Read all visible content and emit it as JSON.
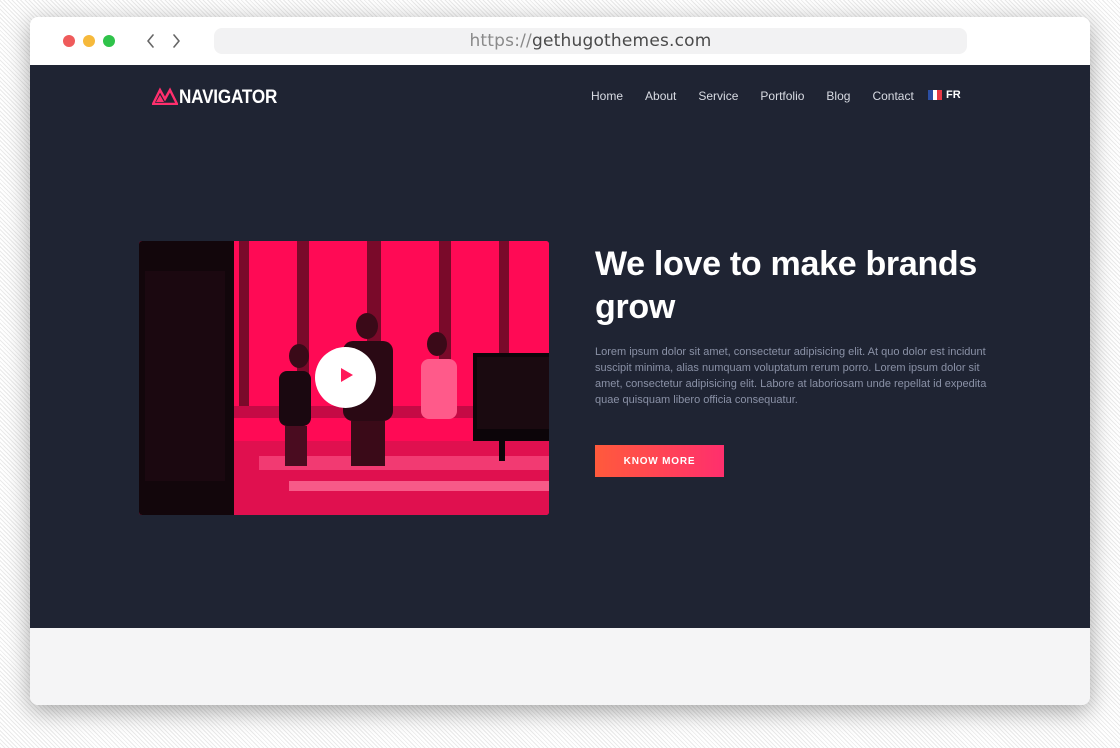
{
  "browser": {
    "url_protocol": "https://",
    "url_host": "gethugothemes.com"
  },
  "site": {
    "logo_text": "NAVIGATOR",
    "menu": [
      "Home",
      "About",
      "Service",
      "Portfolio",
      "Blog",
      "Contact"
    ],
    "language": "FR"
  },
  "hero": {
    "headline": "We love to make brands grow",
    "lead": "Lorem ipsum dolor sit amet, consectetur adipisicing elit. At quo dolor est incidunt suscipit minima, alias numquam voluptatum rerum porro. Lorem ipsum dolor sit amet, consectetur adipisicing elit. Labore at laboriosam unde repellat id expedita quae quisquam libero officia consequatur.",
    "cta_label": "KNOW MORE"
  },
  "colors": {
    "hero_background": "#1f2433",
    "accent": "#ff2f6d",
    "cta_gradient_start": "#ff5a3c"
  },
  "icons": {
    "logo": "navigator-logo-icon",
    "play": "play-icon",
    "back": "chevron-left-icon",
    "forward": "chevron-right-icon",
    "flag": "france-flag-icon"
  }
}
